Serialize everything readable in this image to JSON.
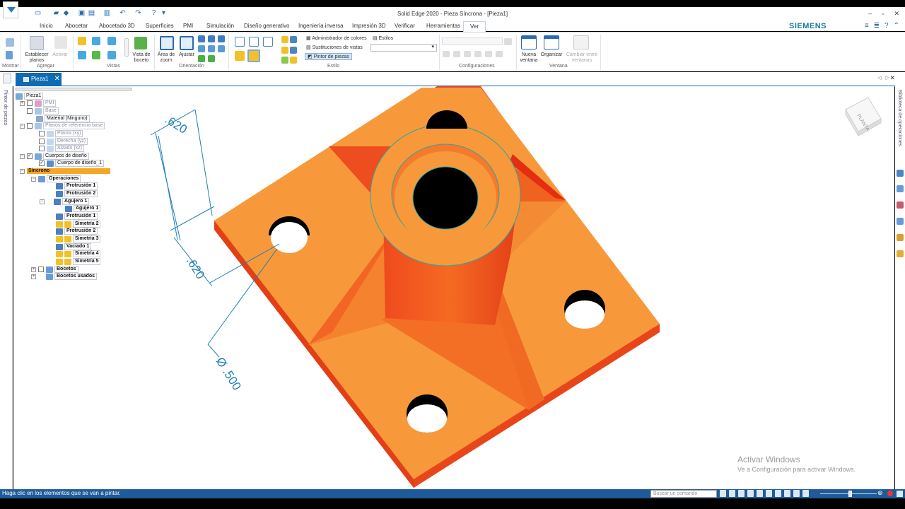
{
  "window": {
    "title": "Solid Edge 2020 - Pieza Síncrona - [Pieza1]",
    "controls": [
      "–",
      "▫",
      "✕"
    ]
  },
  "ribbon": {
    "tabs": [
      "Inicio",
      "Abocetar",
      "Abocetado 3D",
      "Superficies",
      "PMI",
      "Simulación",
      "Diseño generativo",
      "Ingeniería inversa",
      "Impresión 3D",
      "Verificar",
      "Herramientas",
      "Ver"
    ],
    "active_tab": "Ver",
    "brand": "SIEMENS",
    "groups": {
      "mostrar": "Mostrar",
      "agregar": "Agregar",
      "vistas": "Vistas",
      "orientacion": "Orientación",
      "estilo": "Estilo",
      "configuraciones": "Configuraciones",
      "ventana": "Ventana"
    },
    "buttons": {
      "establecer_planos": "Establecer planos",
      "activar": "Activar",
      "vista_boceto": "Vista de boceto",
      "area_zoom": "Área de zoom",
      "ajustar": "Ajustar",
      "admin_colores": "Administrador de colores",
      "estilos": "Estilos",
      "sustituciones": "Sustituciones de vistas",
      "pintor": "Pintor de piezas",
      "nueva_ventana": "Nueva ventana",
      "organizar": "Organizar",
      "cambiar_ventanas": "Cambiar entre ventanas"
    }
  },
  "document_tab": {
    "label": "Pieza1",
    "close": "✕"
  },
  "left_rail": {
    "label": "Pintor de piezas"
  },
  "right_rail": {
    "label": "Biblioteca de operaciones"
  },
  "tree": {
    "root": "Pieza1",
    "pmi": "PMI",
    "base": "Base",
    "material": "Material (Ninguno)",
    "planos": "Planos de referencia base",
    "planta": "Planta (xy)",
    "derecha": "Derecha (yz)",
    "alzado": "Alzado (xz)",
    "cuerpos": "Cuerpos de diseño",
    "cuerpo1": "Cuerpo de diseño_1",
    "sincrono": "Síncrono",
    "operaciones": "Operaciones",
    "prot1": "Protrusión 1",
    "prot2": "Protrusión 2",
    "agujero1": "Agujero 1",
    "agujero1_child": "Agujero 1",
    "prot1b": "Protrusión 1",
    "sim2": "Simetría 2",
    "prot2b": "Protrusión 2",
    "sim3": "Simetría 3",
    "vaciado1": "Vaciado 1",
    "sim4": "Simetría 4",
    "sim5": "Simetría 5",
    "bocetos": "Bocetos",
    "bocetos_usados": "Bocetos usados"
  },
  "dimensions": {
    "d1": ".620",
    "d2": ".620",
    "d3": "Ø .500"
  },
  "view_cube": {
    "face": "PLANTA"
  },
  "status": {
    "message": "Haga clic en los elementos que se van a pintar.",
    "command_placeholder": "Buscar un comando"
  },
  "watermark": {
    "title": "Activar Windows",
    "subtitle": "Ve a Configuración para activar Windows."
  },
  "colors": {
    "part_top": "#f7993a",
    "part_side": "#ee4e1f",
    "rib": "#f1681e",
    "accent": "#0f6cb4",
    "dim": "#1f7fb8"
  }
}
